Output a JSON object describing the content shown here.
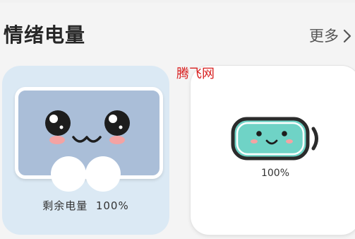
{
  "section": {
    "title": "情绪电量",
    "more_label": "更多"
  },
  "watermark": "腾飞网",
  "cards": [
    {
      "remaining_label": "剩余电量",
      "percent": "100%"
    },
    {
      "percent": "100%"
    }
  ],
  "colors": {
    "card_left_bg": "#dbe9f4",
    "tv_screen": "#aabed8",
    "battery_fill": "#6fd3c6",
    "cheek": "#f4a3a3",
    "watermark": "#d81e1e"
  },
  "icons": [
    "chevron-right-icon",
    "cute-tv-face-icon",
    "battery-face-icon"
  ]
}
